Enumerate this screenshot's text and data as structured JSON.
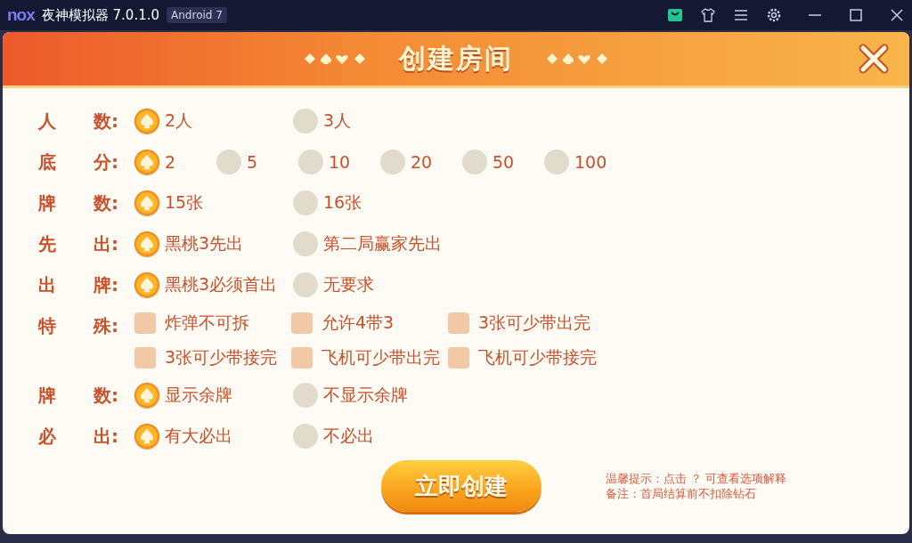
{
  "window": {
    "logo": "nox",
    "title": "夜神模拟器 7.0.1.0",
    "badge": "Android 7"
  },
  "dialog": {
    "title": "创建房间"
  },
  "rows": [
    {
      "kind": "radio",
      "label": [
        "人",
        "数:"
      ],
      "options": [
        {
          "text": "2人",
          "selected": true
        },
        {
          "text": "3人",
          "selected": false
        }
      ]
    },
    {
      "kind": "radio",
      "label": [
        "底",
        "分:"
      ],
      "options": [
        {
          "text": "2",
          "selected": true
        },
        {
          "text": "5",
          "selected": false
        },
        {
          "text": "10",
          "selected": false
        },
        {
          "text": "20",
          "selected": false
        },
        {
          "text": "50",
          "selected": false
        },
        {
          "text": "100",
          "selected": false
        }
      ]
    },
    {
      "kind": "radio",
      "label": [
        "牌",
        "数:"
      ],
      "options": [
        {
          "text": "15张",
          "selected": true
        },
        {
          "text": "16张",
          "selected": false
        }
      ]
    },
    {
      "kind": "radio",
      "label": [
        "先",
        "出:"
      ],
      "options": [
        {
          "text": "黑桃3先出",
          "selected": true
        },
        {
          "text": "第二局赢家先出",
          "selected": false
        }
      ]
    },
    {
      "kind": "radio",
      "label": [
        "出",
        "牌:"
      ],
      "options": [
        {
          "text": "黑桃3必须首出",
          "selected": true
        },
        {
          "text": "无要求",
          "selected": false
        }
      ]
    },
    {
      "kind": "checkbox",
      "label": [
        "特",
        "殊:"
      ],
      "options": [
        {
          "text": "炸弹不可拆",
          "checked": false
        },
        {
          "text": "允许4带3",
          "checked": false
        },
        {
          "text": "3张可少带出完",
          "checked": false
        },
        {
          "text": "3张可少带接完",
          "checked": false
        },
        {
          "text": "飞机可少带出完",
          "checked": false
        },
        {
          "text": "飞机可少带接完",
          "checked": false
        }
      ]
    },
    {
      "kind": "radio",
      "label": [
        "牌",
        "数:"
      ],
      "options": [
        {
          "text": "显示余牌",
          "selected": true
        },
        {
          "text": "不显示余牌",
          "selected": false
        }
      ]
    },
    {
      "kind": "radio",
      "label": [
        "必",
        "出:"
      ],
      "options": [
        {
          "text": "有大必出",
          "selected": true
        },
        {
          "text": "不必出",
          "selected": false
        }
      ]
    }
  ],
  "create_button": "立即创建",
  "notes": [
    "温馨提示：点击 ？ 可查看选项解释",
    "备注：首局结算前不扣除钻石"
  ]
}
